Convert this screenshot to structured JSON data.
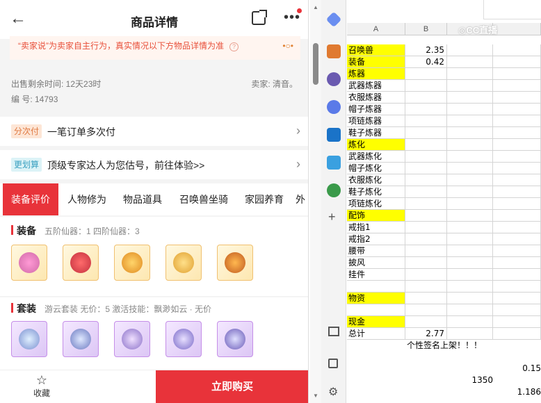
{
  "header": {
    "title": "商品详情",
    "back": "←",
    "more": "•••"
  },
  "notice": {
    "text": "“卖家说”为卖家自主行为，真实情况以下方物品详情为准",
    "help": "?",
    "dots": "•○•"
  },
  "info": {
    "remaining": "出售剩余时间: 12天23时",
    "seller": "卖家: 清音。",
    "code": "编  号: 14793"
  },
  "rows": [
    {
      "tag": "分次付",
      "text": "一笔订单多次付",
      "chev": "›"
    },
    {
      "tag": "更划算",
      "text": "顶级专家达人为您估号，前往体验>>",
      "chev": "›"
    }
  ],
  "tabs": [
    "装备评价",
    "人物修为",
    "物品道具",
    "召唤兽坐骑",
    "家园养育",
    "外"
  ],
  "equipment": {
    "title": "装备",
    "sub": "五阶仙器：1   四阶仙器：3"
  },
  "suits": {
    "title": "套装",
    "sub": "游云套装   无价：5   激活技能：飘渺如云 · 无价"
  },
  "bottom": {
    "fav": "收藏",
    "buy": "立即购买",
    "star": "☆"
  },
  "sheet": {
    "watermark": "◎CC直播",
    "col_a": "A",
    "col_b": "B",
    "rows": [
      {
        "a": "召唤兽",
        "b": "2.35",
        "hl": true
      },
      {
        "a": "装备",
        "b": "0.42",
        "hl": true
      },
      {
        "a": "炼器",
        "b": "",
        "hl": true
      },
      {
        "a": "武器炼器",
        "b": "",
        "hl": false
      },
      {
        "a": "衣服炼器",
        "b": "",
        "hl": false
      },
      {
        "a": "帽子炼器",
        "b": "",
        "hl": false
      },
      {
        "a": "项链炼器",
        "b": "",
        "hl": false
      },
      {
        "a": "鞋子炼器",
        "b": "",
        "hl": false
      },
      {
        "a": "炼化",
        "b": "",
        "hl": true
      },
      {
        "a": "武器炼化",
        "b": "",
        "hl": false
      },
      {
        "a": "帽子炼化",
        "b": "",
        "hl": false
      },
      {
        "a": "衣服炼化",
        "b": "",
        "hl": false
      },
      {
        "a": "鞋子炼化",
        "b": "",
        "hl": false
      },
      {
        "a": "项链炼化",
        "b": "",
        "hl": false
      },
      {
        "a": "配饰",
        "b": "",
        "hl": true
      },
      {
        "a": "戒指1",
        "b": "",
        "hl": false
      },
      {
        "a": "戒指2",
        "b": "",
        "hl": false
      },
      {
        "a": "腰带",
        "b": "",
        "hl": false
      },
      {
        "a": "披风",
        "b": "",
        "hl": false
      },
      {
        "a": "挂件",
        "b": "",
        "hl": false
      },
      {
        "a": "",
        "b": "",
        "hl": false
      },
      {
        "a": "物资",
        "b": "",
        "hl": true
      },
      {
        "a": "",
        "b": "",
        "hl": false
      },
      {
        "a": "现金",
        "b": "",
        "hl": true
      },
      {
        "a": "总计",
        "b": "2.77",
        "hl": false
      }
    ],
    "banner": "个性签名上架！！！",
    "val1": "0.15",
    "val2": "1350",
    "val3": "1.186"
  }
}
